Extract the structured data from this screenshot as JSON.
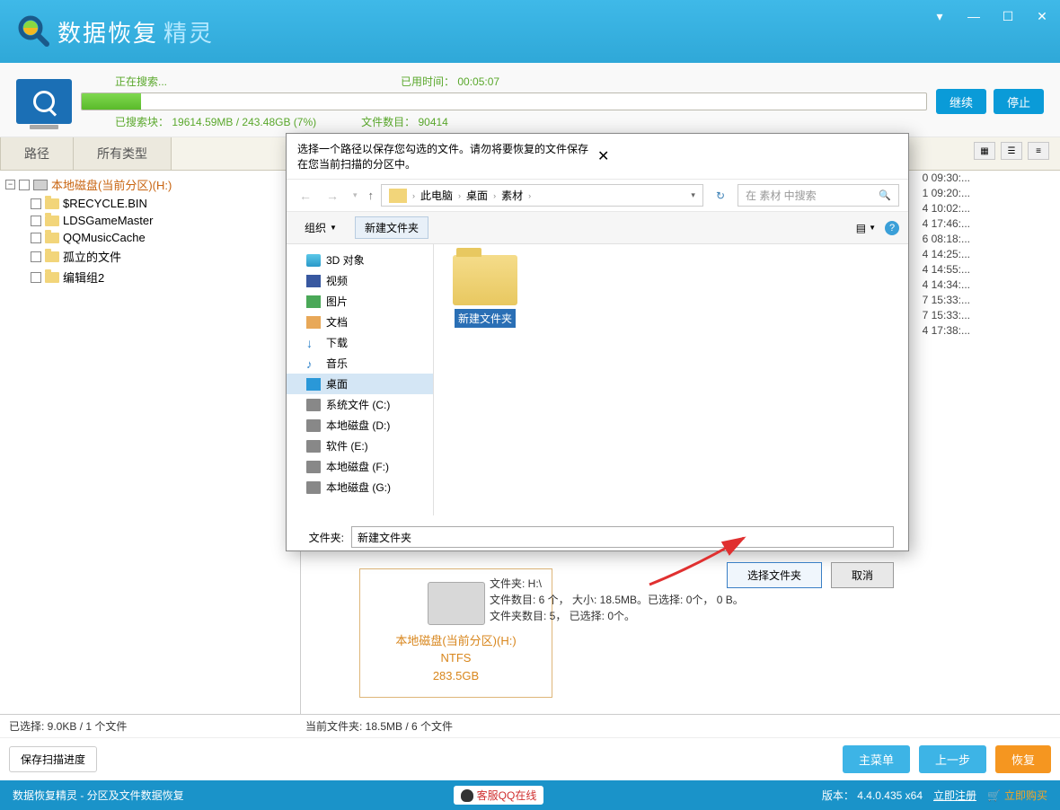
{
  "app": {
    "name_main": "数据恢复",
    "name_sub": "精灵"
  },
  "scan": {
    "searching": "正在搜索...",
    "elapsed_label": "已用时间：",
    "elapsed": "00:05:07",
    "clusters_label": "已搜索块：",
    "clusters": "19614.59MB / 243.48GB (7%)",
    "files_label": "文件数目：",
    "files": "90414",
    "continue": "继续",
    "stop": "停止"
  },
  "tabs": {
    "path": "路径",
    "all_types": "所有类型"
  },
  "tree": {
    "root": "本地磁盘(当前分区)(H:)",
    "items": [
      "$RECYCLE.BIN",
      "LDSGameMaster",
      "QQMusicCache",
      "孤立的文件",
      "编辑组2"
    ]
  },
  "timestamps": [
    "0 09:30:...",
    "1 09:20:...",
    "4 10:02:...",
    "4 17:46:...",
    "6 08:18:...",
    "4 14:25:...",
    "4 14:55:...",
    "4 14:34:...",
    "7 15:33:...",
    "7 15:33:...",
    "4 17:38:..."
  ],
  "drive_card": {
    "name": "本地磁盘(当前分区)(H:)",
    "fs": "NTFS",
    "size": "283.5GB"
  },
  "drive_info": {
    "line1": "文件夹: H:\\",
    "line2": "文件数目: 6 个， 大小: 18.5MB。已选择: 0个， 0 B。",
    "line3": "文件夹数目: 5， 已选择: 0个。"
  },
  "footer": {
    "selected": "已选择: 9.0KB / 1 个文件",
    "current": "当前文件夹:  18.5MB / 6 个文件",
    "save_progress": "保存扫描进度",
    "main_menu": "主菜单",
    "prev": "上一步",
    "recover": "恢复"
  },
  "bottom": {
    "breadcrumb": "数据恢复精灵 - 分区及文件数据恢复",
    "qq_online": "客服QQ在线",
    "version_label": "版本：",
    "version": "4.4.0.435 x64",
    "register": "立即注册",
    "buy": "立即购买"
  },
  "dialog": {
    "title": "选择一个路径以保存您勾选的文件。请勿将要恢复的文件保存在您当前扫描的分区中。",
    "breadcrumbs": [
      "此电脑",
      "桌面",
      "素材"
    ],
    "search_placeholder": "在 素材 中搜索",
    "organize": "组织",
    "new_folder": "新建文件夹",
    "tree": [
      {
        "label": "3D 对象",
        "icon": "i3d"
      },
      {
        "label": "视频",
        "icon": "ivid"
      },
      {
        "label": "图片",
        "icon": "iimg"
      },
      {
        "label": "文档",
        "icon": "idoc"
      },
      {
        "label": "下载",
        "icon": "idown"
      },
      {
        "label": "音乐",
        "icon": "imus"
      },
      {
        "label": "桌面",
        "icon": "idesk",
        "selected": true
      },
      {
        "label": "系统文件 (C:)",
        "icon": "idrv"
      },
      {
        "label": "本地磁盘 (D:)",
        "icon": "idrv"
      },
      {
        "label": "软件 (E:)",
        "icon": "idrv"
      },
      {
        "label": "本地磁盘 (F:)",
        "icon": "idrv"
      },
      {
        "label": "本地磁盘 (G:)",
        "icon": "idrv"
      }
    ],
    "folder_item_name": "新建文件夹",
    "file_label": "文件夹:",
    "file_value": "新建文件夹",
    "select_btn": "选择文件夹",
    "cancel_btn": "取消"
  }
}
